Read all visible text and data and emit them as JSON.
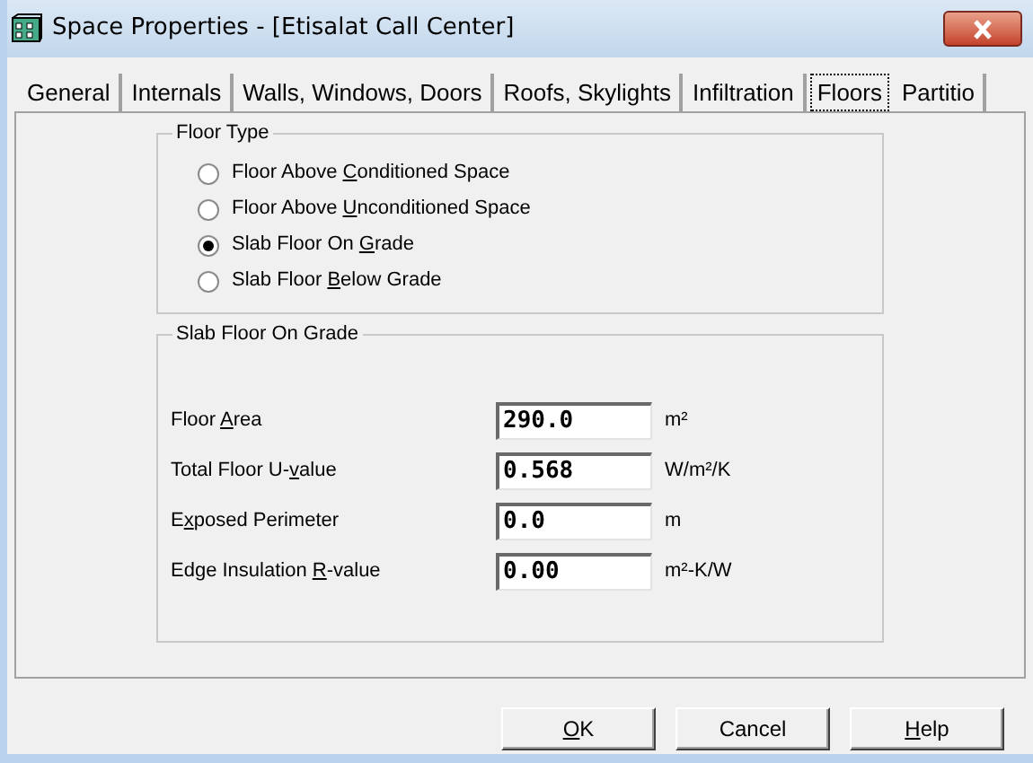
{
  "window": {
    "title": "Space Properties - [Etisalat Call Center]"
  },
  "tabs": [
    {
      "label": "General",
      "selected": false
    },
    {
      "label": "Internals",
      "selected": false
    },
    {
      "label": "Walls, Windows, Doors",
      "selected": false
    },
    {
      "label": "Roofs, Skylights",
      "selected": false
    },
    {
      "label": "Infiltration",
      "selected": false
    },
    {
      "label": "Floors",
      "selected": true
    },
    {
      "label": "Partitio",
      "selected": false
    }
  ],
  "floor_type": {
    "title": "Floor Type",
    "options": [
      {
        "label": [
          "Floor Above ",
          "C",
          "onditioned Space"
        ],
        "selected": false
      },
      {
        "label": [
          "Floor Above ",
          "U",
          "nconditioned Space"
        ],
        "selected": false
      },
      {
        "label": [
          "Slab Floor On ",
          "G",
          "rade"
        ],
        "selected": true
      },
      {
        "label": [
          "Slab Floor ",
          "B",
          "elow Grade"
        ],
        "selected": false
      }
    ]
  },
  "slab": {
    "title": "Slab Floor On Grade",
    "fields": [
      {
        "label": [
          "Floor ",
          "A",
          "rea"
        ],
        "value": "290.0",
        "unit": "m²"
      },
      {
        "label": [
          "Total Floor U-",
          "v",
          "alue"
        ],
        "value": "0.568",
        "unit": "W/m²/K"
      },
      {
        "label": [
          "E",
          "x",
          "posed Perimeter"
        ],
        "value": "0.0",
        "unit": "m"
      },
      {
        "label": [
          "Edge Insulation ",
          "R",
          "-value"
        ],
        "value": "0.00",
        "unit": "m²-K/W"
      }
    ]
  },
  "buttons": [
    {
      "label": {
        "key": "O",
        "after": "K"
      }
    },
    {
      "label": {
        "before": "Cancel"
      }
    },
    {
      "label": {
        "key": "H",
        "after": "elp"
      }
    }
  ]
}
